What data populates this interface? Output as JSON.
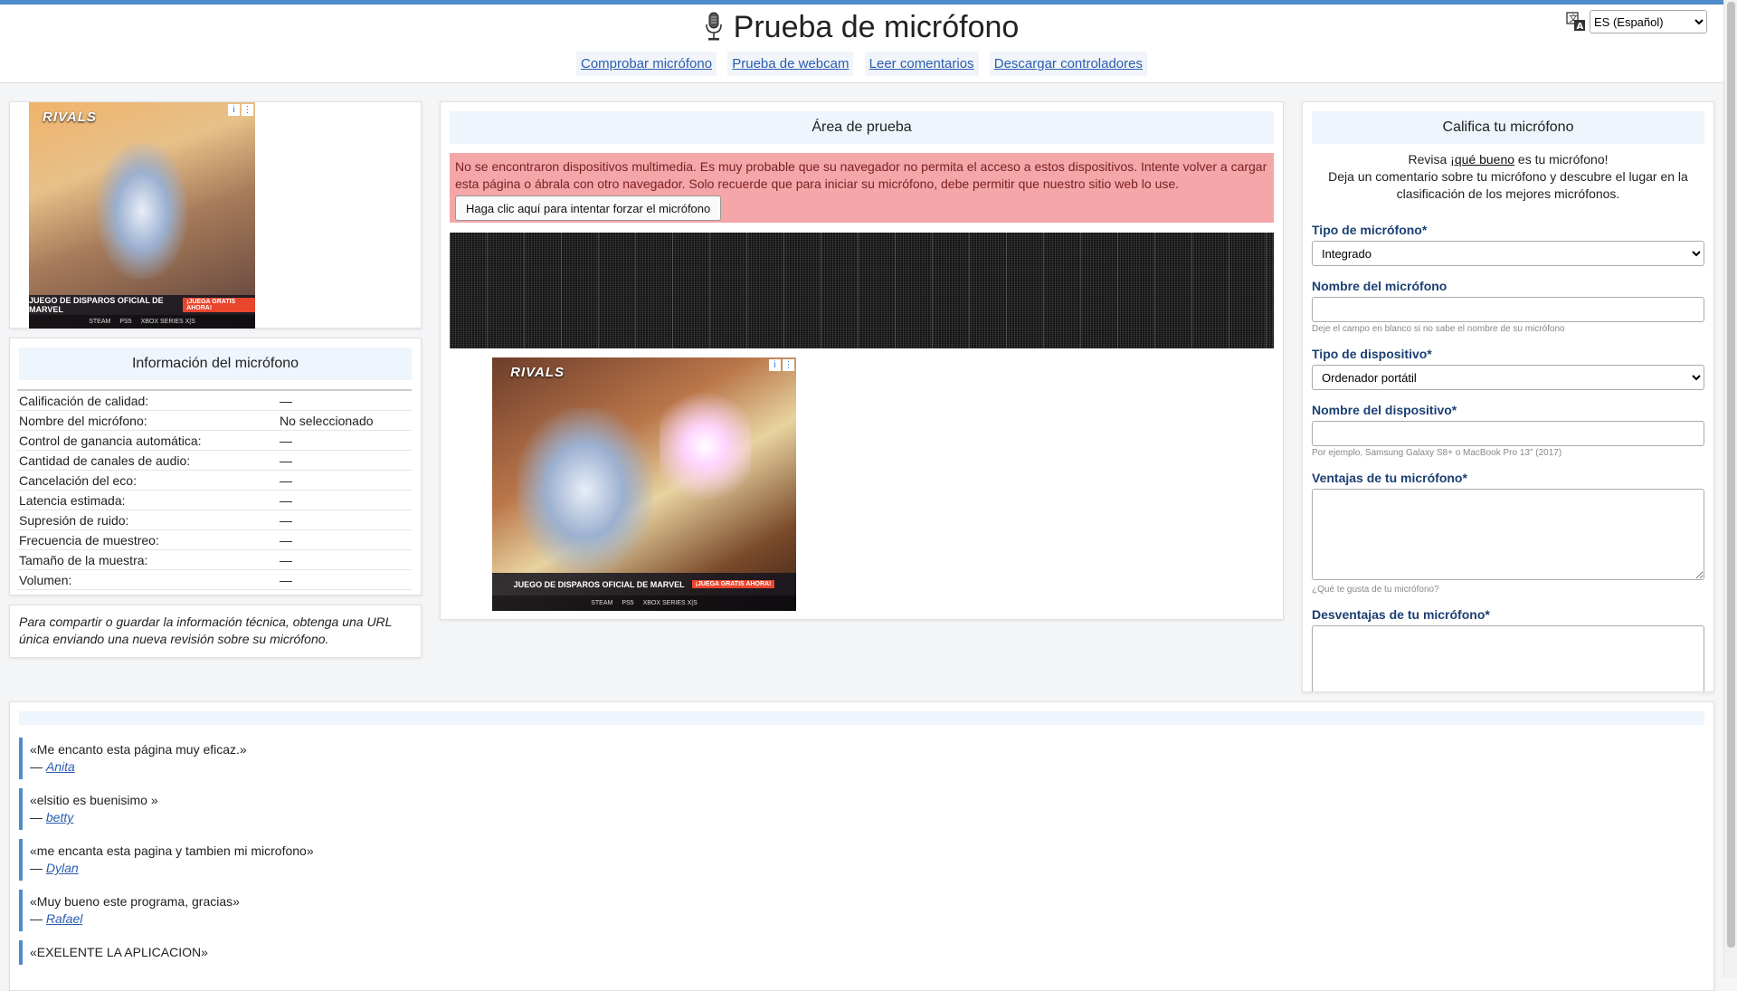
{
  "header": {
    "title": "Prueba de micrófono",
    "nav": [
      "Comprobar micrófono",
      "Prueba de webcam",
      "Leer comentarios",
      "Descargar controladores"
    ],
    "language": "ES (Español)"
  },
  "ads": {
    "logo": "RIVALS",
    "banner": "JUEGO DE DISPAROS OFICIAL DE MARVEL",
    "tag": "¡JUEGA GRATIS AHORA!",
    "platforms": [
      "STEAM",
      "PS5",
      "XBOX SERIES X|S"
    ]
  },
  "mic_info": {
    "title": "Información del micrófono",
    "rows": [
      {
        "label": "Calificación de calidad:",
        "value": "—"
      },
      {
        "label": "Nombre del micrófono:",
        "value": "No seleccionado"
      },
      {
        "label": "Control de ganancia automática:",
        "value": "—"
      },
      {
        "label": "Cantidad de canales de audio:",
        "value": "—"
      },
      {
        "label": "Cancelación del eco:",
        "value": "—"
      },
      {
        "label": "Latencia estimada:",
        "value": "—"
      },
      {
        "label": "Supresión de ruido:",
        "value": "—"
      },
      {
        "label": "Frecuencia de muestreo:",
        "value": "—"
      },
      {
        "label": "Tamaño de la muestra:",
        "value": "—"
      },
      {
        "label": "Volumen:",
        "value": "—"
      }
    ],
    "note": "Para compartir o guardar la información técnica, obtenga una URL única enviando una nueva revisión sobre su micrófono."
  },
  "test_area": {
    "title": "Área de prueba",
    "alert": "No se encontraron dispositivos multimedia. Es muy probable que su navegador no permita el acceso a estos dispositivos. Intente volver a cargar esta página o ábrala con otro navegador. Solo recuerde que para iniciar su micrófono, debe permitir que nuestro sitio web lo use.",
    "force_button": "Haga clic aquí para intentar forzar el micrófono"
  },
  "rate": {
    "title": "Califica tu micrófono",
    "intro_prefix": "Revisa ",
    "intro_link": "¡qué bueno",
    "intro_suffix": " es tu micrófono!",
    "intro_line2": "Deja un comentario sobre tu micrófono y descubre el lugar en la clasificación de los mejores micrófonos.",
    "mic_type_label": "Tipo de micrófono*",
    "mic_type_value": "Integrado",
    "mic_name_label": "Nombre del micrófono",
    "mic_name_hint": "Deje el campo en blanco si no sabe el nombre de su micrófono",
    "device_type_label": "Tipo de dispositivo*",
    "device_type_value": "Ordenador portátil",
    "device_name_label": "Nombre del dispositivo*",
    "device_name_hint": "Por ejemplo, Samsung Galaxy S8+ o MacBook Pro 13\" (2017)",
    "pros_label": "Ventajas de tu micrófono*",
    "pros_hint": "¿Qué te gusta de tu micrófono?",
    "cons_label": "Desventajas de tu micrófono*"
  },
  "comments": [
    {
      "text": "«Me encanto esta página muy eficaz.»",
      "author": "Anita"
    },
    {
      "text": "«elsitio es buenisimo »",
      "author": "betty"
    },
    {
      "text": "«me encanta esta pagina y tambien mi microfono»",
      "author": "Dylan"
    },
    {
      "text": "«Muy bueno este programa, gracias»",
      "author": "Rafael"
    },
    {
      "text": "«EXELENTE LA APLICACION»",
      "author": ""
    }
  ]
}
